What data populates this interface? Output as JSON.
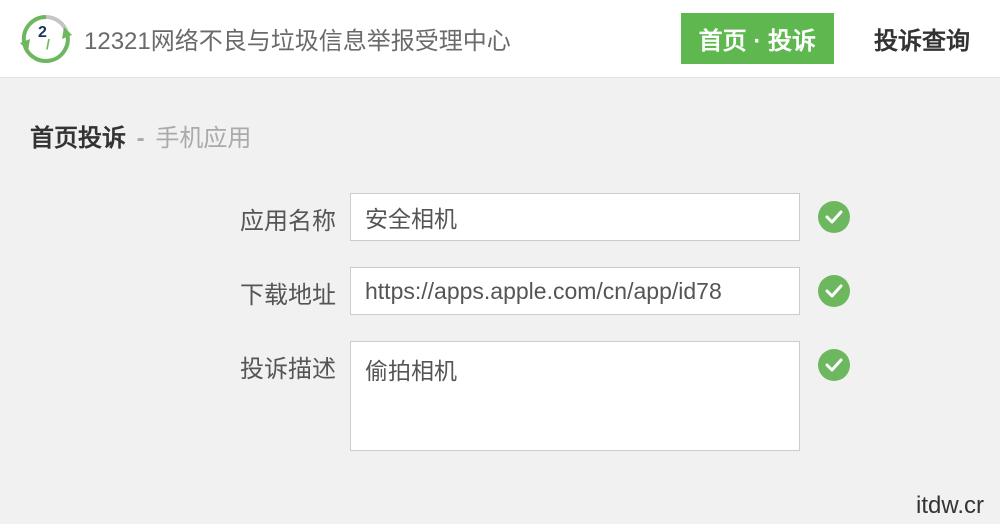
{
  "header": {
    "site_title": "12321网络不良与垃圾信息举报受理中心",
    "nav": {
      "home_complaint": "首页 · 投诉",
      "complaint_query": "投诉查询"
    }
  },
  "breadcrumb": {
    "main": "首页投诉",
    "separator": "-",
    "sub": "手机应用"
  },
  "form": {
    "app_name": {
      "label": "应用名称",
      "value": "安全相机"
    },
    "download_url": {
      "label": "下载地址",
      "value": "https://apps.apple.com/cn/app/id78"
    },
    "complaint_desc": {
      "label": "投诉描述",
      "value": "偷拍相机"
    }
  },
  "watermark": "itdw.cr",
  "colors": {
    "accent": "#5eb74f",
    "check": "#6db85f"
  }
}
